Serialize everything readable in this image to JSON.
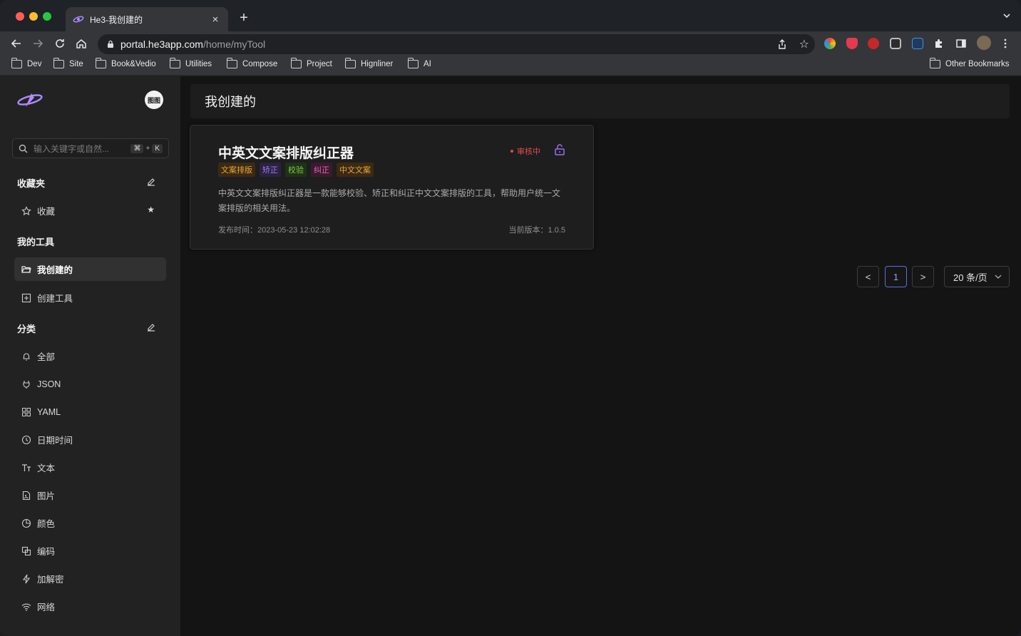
{
  "browser": {
    "tab_title": "He3-我创建的",
    "tab_close": "×",
    "new_tab": "+",
    "url_host": "portal.he3app.com",
    "url_path": "/home/myTool",
    "bookmarks": [
      "Dev",
      "Site",
      "Book&Vedio",
      "Utilities",
      "Compose",
      "Project",
      "Hignliner",
      "AI"
    ],
    "other_bookmarks": "Other Bookmarks"
  },
  "sidebar": {
    "avatar_text": "图图",
    "search_placeholder": "输入关键字或自然...",
    "shortcut_key1": "⌘",
    "shortcut_plus": "+",
    "shortcut_key2": "K",
    "favorites_title": "收藏夹",
    "favorites_items": [
      {
        "label": "收藏",
        "icon": "star-outline-icon"
      }
    ],
    "my_tools_title": "我的工具",
    "my_tools_items": [
      {
        "label": "我创建的",
        "icon": "folder-open-icon",
        "active": true
      },
      {
        "label": "创建工具",
        "icon": "plus-square-icon",
        "active": false
      }
    ],
    "category_title": "分类",
    "category_items": [
      {
        "label": "全部",
        "icon": "bell-icon"
      },
      {
        "label": "JSON",
        "icon": "plug-icon"
      },
      {
        "label": "YAML",
        "icon": "grid-icon"
      },
      {
        "label": "日期时间",
        "icon": "clock-icon"
      },
      {
        "label": "文本",
        "icon": "text-icon"
      },
      {
        "label": "图片",
        "icon": "image-file-icon"
      },
      {
        "label": "颜色",
        "icon": "pie-icon"
      },
      {
        "label": "编码",
        "icon": "copy-icon"
      },
      {
        "label": "加解密",
        "icon": "bolt-icon"
      },
      {
        "label": "网络",
        "icon": "wifi-icon"
      }
    ]
  },
  "main": {
    "page_title": "我创建的",
    "card": {
      "title": "中英文文案排版纠正器",
      "status": "审核中",
      "tags": [
        {
          "label": "文案排版",
          "color": "#e8a33d",
          "bg": "#3a2a12"
        },
        {
          "label": "矫正",
          "color": "#9b7bf0",
          "bg": "#2a2240"
        },
        {
          "label": "校验",
          "color": "#7fc94a",
          "bg": "#1f3216"
        },
        {
          "label": "纠正",
          "color": "#e06bb0",
          "bg": "#3a1a2e"
        },
        {
          "label": "中文文案",
          "color": "#e8a33d",
          "bg": "#3a2a12"
        }
      ],
      "description": "中英文文案排版纠正器是一款能够校验、矫正和纠正中文文案排版的工具，帮助用户统一文案排版的相关用法。",
      "publish_time": "发布时间：2023-05-23 12:02:28",
      "version": "当前版本：1.0.5"
    },
    "pagination": {
      "prev": "<",
      "current_page": "1",
      "next": ">",
      "page_size": "20 条/页"
    }
  },
  "colors": {
    "accent": "#5b6ee1",
    "status_red": "#e5484d",
    "lock_purple": "#9b6cf0"
  }
}
